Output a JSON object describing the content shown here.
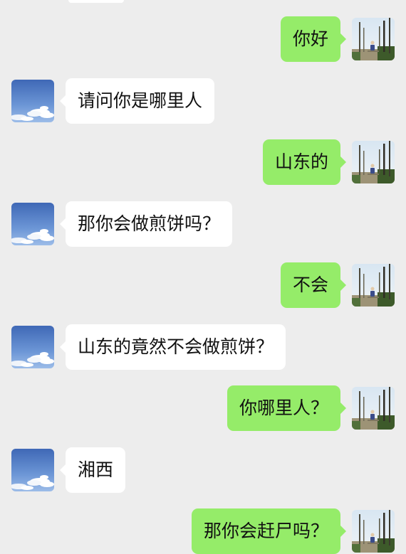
{
  "chat": {
    "messages": [
      {
        "side": "right",
        "text": "你好"
      },
      {
        "side": "left",
        "text": "请问你是哪里人"
      },
      {
        "side": "right",
        "text": "山东的"
      },
      {
        "side": "left",
        "text": "那你会做煎饼吗？"
      },
      {
        "side": "right",
        "text": "不会"
      },
      {
        "side": "left",
        "text": "山东的竟然不会做煎饼？"
      },
      {
        "side": "right",
        "text": "你哪里人？"
      },
      {
        "side": "left",
        "text": "湘西"
      },
      {
        "side": "right",
        "text": "那你会赶尸吗？"
      }
    ]
  },
  "colors": {
    "background": "#ededed",
    "sent_bubble": "#95ec69",
    "received_bubble": "#ffffff",
    "text": "#111111"
  },
  "avatars": {
    "self": "landscape-trees-avatar",
    "other": "blue-sky-clouds-avatar"
  }
}
